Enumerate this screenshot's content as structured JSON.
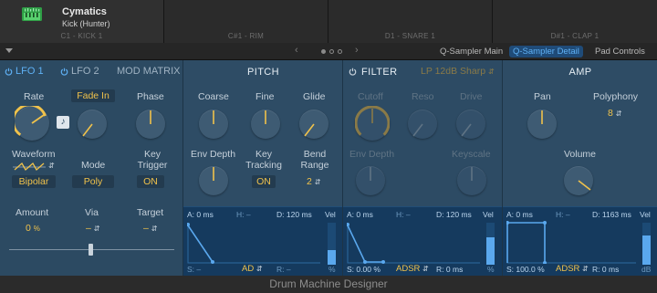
{
  "pads": [
    {
      "name": "Cymatics",
      "kit": "Kick (Hunter)",
      "sub": "C1 - KICK 1",
      "active": true
    },
    {
      "sub": "C#1 - RIM"
    },
    {
      "sub": "D1 - SNARE 1"
    },
    {
      "sub": "D#1 - CLAP 1"
    }
  ],
  "tabs": {
    "main": "Q-Sampler Main",
    "detail": "Q-Sampler Detail",
    "pad_controls": "Pad Controls",
    "nav_left": "‹",
    "nav_right": "›"
  },
  "lfo": {
    "tab1": "LFO 1",
    "tab2": "LFO 2",
    "mod_matrix": "MOD MATRIX",
    "rate_label": "Rate",
    "fade_in": "Fade In",
    "phase_label": "Phase",
    "waveform_label": "Waveform",
    "bipolar": "Bipolar",
    "mode_label": "Mode",
    "mode_value": "Poly",
    "key_trigger_label": "Key Trigger",
    "key_trigger_value": "ON",
    "amount_label": "Amount",
    "amount_value": "0",
    "amount_unit": "%",
    "via_label": "Via",
    "via_value": "–",
    "target_label": "Target",
    "target_value": "–",
    "sync_icon": "note-icon"
  },
  "pitch": {
    "title": "PITCH",
    "coarse": "Coarse",
    "fine": "Fine",
    "glide": "Glide",
    "env_depth": "Env Depth",
    "key_tracking": "Key Tracking",
    "key_tracking_value": "ON",
    "bend_range": "Bend Range",
    "bend_range_value": "2",
    "env": {
      "a_label": "A:",
      "a_val": "0",
      "a_unit": "ms",
      "h_label": "H:",
      "h_val": "–",
      "d_label": "D:",
      "d_val": "120",
      "d_unit": "ms",
      "vel": "Vel",
      "s_label": "S:",
      "s_val": "–",
      "r_label": "R:",
      "r_val": "–",
      "mode": "AD",
      "pct": "%"
    }
  },
  "filter": {
    "title": "FILTER",
    "type": "LP 12dB Sharp",
    "cutoff": "Cutoff",
    "reso": "Reso",
    "drive": "Drive",
    "env_depth": "Env Depth",
    "keyscale": "Keyscale",
    "env": {
      "a_label": "A:",
      "a_val": "0",
      "a_unit": "ms",
      "h_label": "H:",
      "h_val": "–",
      "d_label": "D:",
      "d_val": "120",
      "d_unit": "ms",
      "vel": "Vel",
      "s_label": "S:",
      "s_val": "0.00",
      "s_unit": "%",
      "r_label": "R:",
      "r_val": "0",
      "r_unit": "ms",
      "mode": "ADSR",
      "pct": "%"
    }
  },
  "amp": {
    "title": "AMP",
    "pan": "Pan",
    "polyphony": "Polyphony",
    "polyphony_value": "8",
    "volume": "Volume",
    "env": {
      "a_label": "A:",
      "a_val": "0",
      "a_unit": "ms",
      "h_label": "H:",
      "h_val": "–",
      "d_label": "D:",
      "d_val": "1163",
      "d_unit": "ms",
      "vel": "Vel",
      "s_label": "S:",
      "s_val": "100.0",
      "s_unit": "%",
      "r_label": "R:",
      "r_val": "0",
      "r_unit": "ms",
      "mode": "ADSR",
      "db": "dB"
    }
  },
  "footer": "Drum Machine Designer",
  "colors": {
    "accent": "#f0c24b",
    "panel": "#2c4a62",
    "env_bg": "#153a5e",
    "env_line": "#5aa8ee",
    "tab_sel": "#5fb1f5"
  }
}
